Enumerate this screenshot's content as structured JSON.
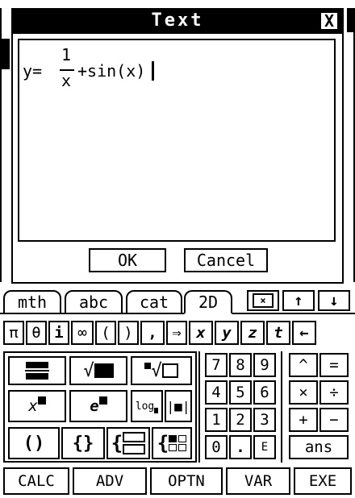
{
  "dialog": {
    "title": "Text",
    "close_label": "X",
    "expression": {
      "prefix": "y=",
      "numerator": "1",
      "denominator": "x",
      "suffix": "+sin(x)"
    },
    "ok_label": "OK",
    "cancel_label": "Cancel"
  },
  "keyboard": {
    "tabs": [
      "mth",
      "abc",
      "cat",
      "2D"
    ],
    "row1": [
      "π",
      "θ",
      "i",
      "∞",
      "(",
      ")",
      ",",
      "⇒",
      "x",
      "y",
      "z",
      "t",
      "←"
    ],
    "templates": {
      "fraction": "fraction-template",
      "sqrt": "√",
      "nthroot": "√",
      "power": "x",
      "exp": "e",
      "log": "log",
      "abs": "|■|",
      "paren": "()",
      "brace": "{}",
      "brace_stack": "{",
      "matrix": "{"
    },
    "numpad": [
      [
        "7",
        "8",
        "9"
      ],
      [
        "4",
        "5",
        "6"
      ],
      [
        "1",
        "2",
        "3"
      ],
      [
        "0",
        ".",
        "E"
      ]
    ],
    "ops": [
      [
        "^",
        "="
      ],
      [
        "×",
        "÷"
      ],
      [
        "+",
        "−"
      ]
    ],
    "ans_label": "ans",
    "bottom": [
      "CALC",
      "ADV",
      "OPTN",
      "VAR",
      "EXE"
    ]
  }
}
